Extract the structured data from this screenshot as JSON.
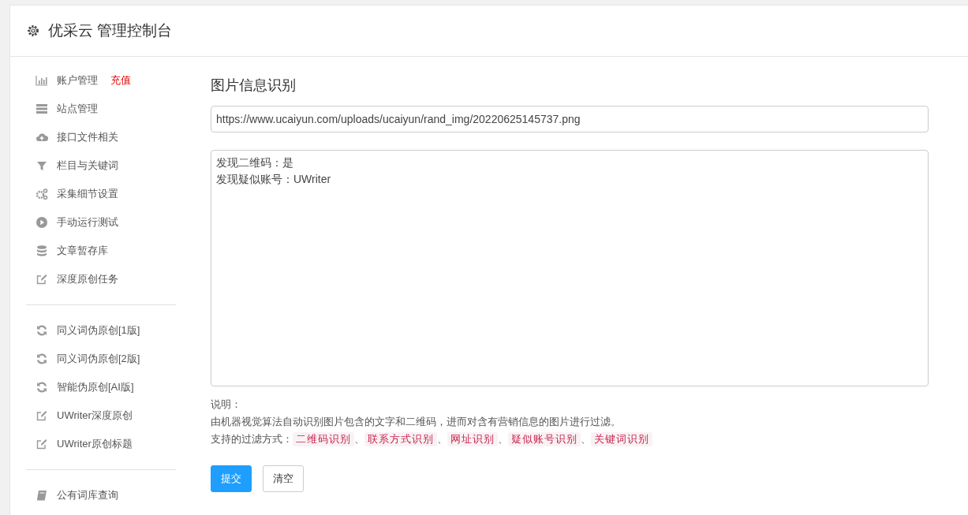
{
  "header": {
    "title": "优采云 管理控制台"
  },
  "sidebar": {
    "groups": [
      {
        "items": [
          {
            "label": "账户管理",
            "link": "充值"
          },
          {
            "label": "站点管理"
          },
          {
            "label": "接口文件相关"
          },
          {
            "label": "栏目与关键词"
          },
          {
            "label": "采集细节设置"
          },
          {
            "label": "手动运行测试"
          },
          {
            "label": "文章暂存库"
          },
          {
            "label": "深度原创任务"
          }
        ]
      },
      {
        "items": [
          {
            "label": "同义词伪原创[1版]"
          },
          {
            "label": "同义词伪原创[2版]"
          },
          {
            "label": "智能伪原创[AI版]"
          },
          {
            "label": "UWriter深度原创"
          },
          {
            "label": "UWriter原创标题"
          }
        ]
      },
      {
        "items": [
          {
            "label": "公有词库查询"
          }
        ]
      }
    ]
  },
  "main": {
    "title": "图片信息识别",
    "url_field": {
      "value": "https://www.ucaiyun.com/uploads/ucaiyun/rand_img/20220625145737.png"
    },
    "result_box": {
      "lines": [
        "发现二维码：是",
        "发现疑似账号：UWriter"
      ]
    },
    "notes": {
      "heading": "说明：",
      "description": "由机器视觉算法自动识别图片包含的文字和二维码，进而对含有营销信息的图片进行过滤。",
      "filters_label": "支持的过滤方式：",
      "separator": "、",
      "filters": [
        "二维码识别",
        "联系方式识别",
        "网址识别",
        "疑似账号识别",
        "关键词识别"
      ]
    },
    "buttons": [
      {
        "label": "提交",
        "kind": "primary"
      },
      {
        "label": "清空",
        "kind": "default"
      }
    ]
  }
}
